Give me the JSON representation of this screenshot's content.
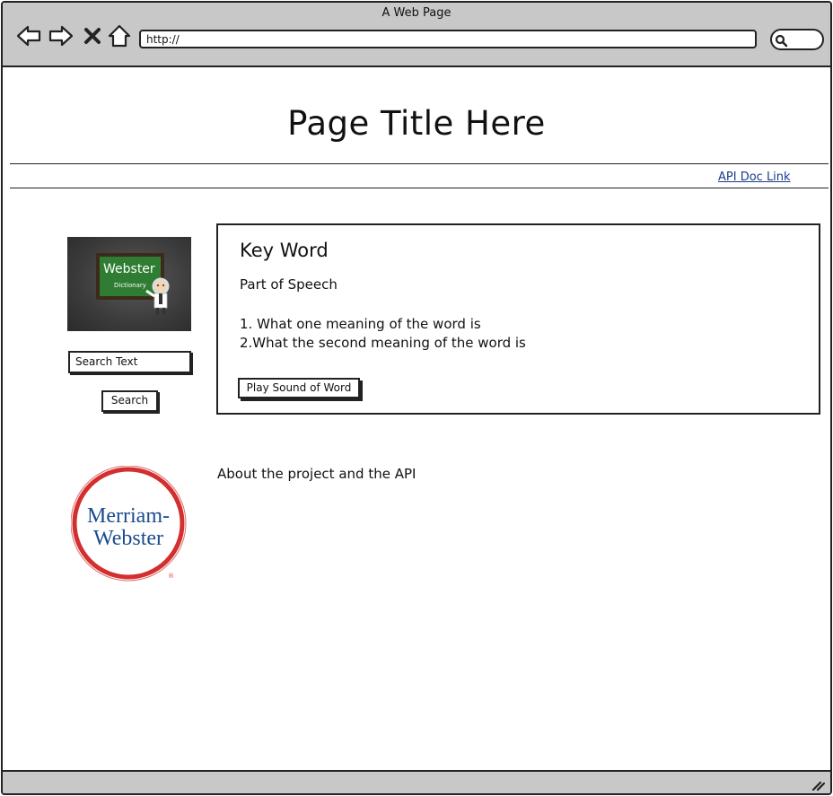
{
  "window": {
    "title": "A Web Page"
  },
  "browser": {
    "url": "http://",
    "icons": [
      "back-arrow-icon",
      "forward-arrow-icon",
      "close-x-icon",
      "home-icon",
      "search-magnifier-icon"
    ]
  },
  "page": {
    "title": "Page Title Here",
    "api_link": "API Doc Link"
  },
  "sidebar": {
    "logo_text": "Webster",
    "logo_subtext": "Dictionary",
    "search_field_value": "Search Text",
    "search_button": "Search"
  },
  "result": {
    "key_word": "Key Word",
    "part_of_speech": "Part of Speech",
    "definitions": [
      "1. What one meaning of the word is",
      "2.What the second meaning of the word is"
    ],
    "play_button": "Play Sound of Word"
  },
  "brand_logo": {
    "line1": "Merriam-",
    "line2": "Webster",
    "mark": "®"
  },
  "about": {
    "text": "About the project and the API"
  },
  "colors": {
    "chrome": "#c8c8c8",
    "link": "#1a3c8a",
    "board_green": "#2e7d32",
    "mw_red": "#d32f2f",
    "mw_blue": "#1a4c8f"
  }
}
